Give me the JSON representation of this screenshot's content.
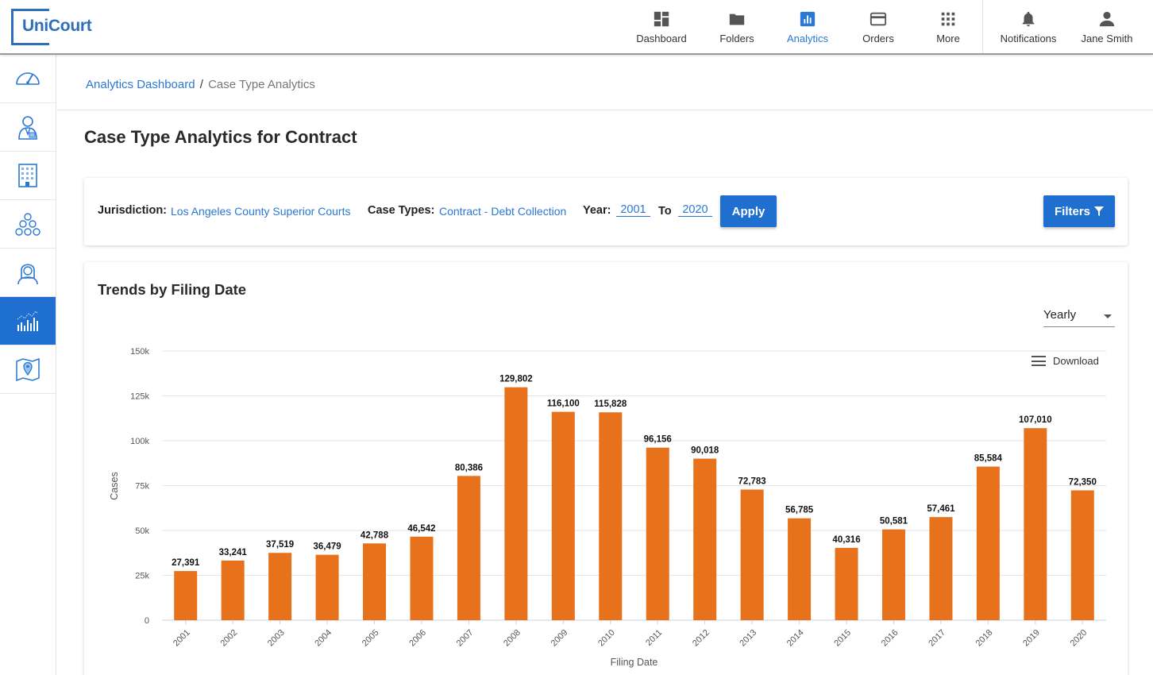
{
  "brand": {
    "name": "UniCourt"
  },
  "nav": {
    "items": [
      {
        "label": "Dashboard",
        "icon": "dashboard-icon"
      },
      {
        "label": "Folders",
        "icon": "folder-icon"
      },
      {
        "label": "Analytics",
        "icon": "analytics-icon",
        "active": true
      },
      {
        "label": "Orders",
        "icon": "credit-card-icon"
      },
      {
        "label": "More",
        "icon": "grid-icon"
      },
      {
        "label": "Notifications",
        "icon": "bell-icon"
      },
      {
        "label": "Jane Smith",
        "icon": "user-icon"
      }
    ]
  },
  "sidebar": {
    "items": [
      {
        "icon": "speedometer-icon"
      },
      {
        "icon": "attorney-icon"
      },
      {
        "icon": "building-icon"
      },
      {
        "icon": "organization-icon"
      },
      {
        "icon": "judge-icon"
      },
      {
        "icon": "analytics-chart-icon",
        "active": true
      },
      {
        "icon": "map-pin-icon"
      }
    ]
  },
  "breadcrumb": {
    "link": "Analytics Dashboard",
    "separator": "/",
    "current": "Case Type Analytics"
  },
  "page": {
    "title": "Case Type Analytics for Contract"
  },
  "filters": {
    "jurisdiction_label": "Jurisdiction:",
    "jurisdiction_value": "Los Angeles County Superior Courts",
    "case_types_label": "Case Types:",
    "case_types_value": "Contract - Debt Collection",
    "year_label": "Year:",
    "year_from": "2001",
    "to_label": "To",
    "year_to": "2020",
    "apply_label": "Apply",
    "filters_label": "Filters"
  },
  "chart_card": {
    "title": "Trends by Filing Date",
    "granularity": "Yearly",
    "download_label": "Download"
  },
  "colors": {
    "accent": "#1e6fd0",
    "bar": "#e8721c",
    "link": "#2a78d4"
  },
  "chart_data": {
    "type": "bar",
    "categories": [
      "2001",
      "2002",
      "2003",
      "2004",
      "2005",
      "2006",
      "2007",
      "2008",
      "2009",
      "2010",
      "2011",
      "2012",
      "2013",
      "2014",
      "2015",
      "2016",
      "2017",
      "2018",
      "2019",
      "2020"
    ],
    "values": [
      27391,
      33241,
      37519,
      36479,
      42788,
      46542,
      80386,
      129802,
      116100,
      115828,
      96156,
      90018,
      72783,
      56785,
      40316,
      50581,
      57461,
      85584,
      107010,
      72350
    ],
    "data_labels": [
      "27,391",
      "33,241",
      "37,519",
      "36,479",
      "42,788",
      "46,542",
      "80,386",
      "129,802",
      "116,100",
      "115,828",
      "96,156",
      "90,018",
      "72,783",
      "56,785",
      "40,316",
      "50,581",
      "57,461",
      "85,584",
      "107,010",
      "72,350"
    ],
    "xlabel": "Filing Date",
    "ylabel": "Cases",
    "ylim": [
      0,
      150000
    ],
    "yticks": [
      0,
      25000,
      50000,
      75000,
      100000,
      125000,
      150000
    ],
    "ytick_labels": [
      "0",
      "25k",
      "50k",
      "75k",
      "100k",
      "125k",
      "150k"
    ],
    "grid": true
  }
}
